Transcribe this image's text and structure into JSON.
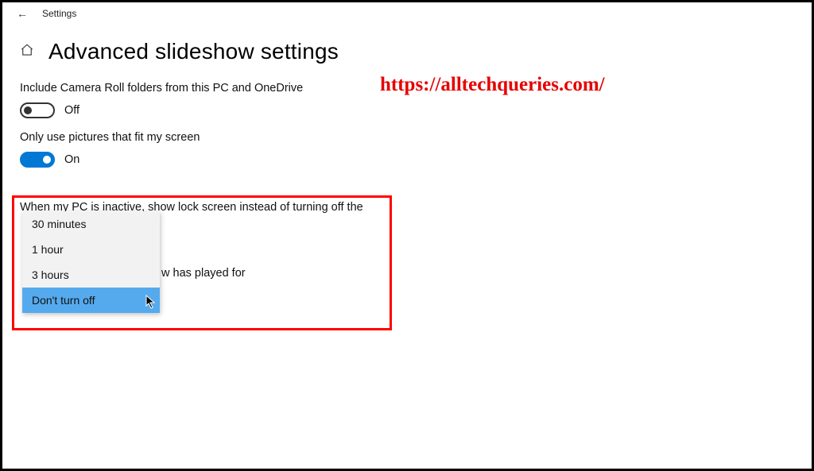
{
  "top": {
    "back": "←",
    "title": "Settings"
  },
  "page": {
    "title": "Advanced slideshow settings"
  },
  "watermark": "https://alltechqueries.com/",
  "settings": {
    "cameraRoll": {
      "label": "Include Camera Roll folders from this PC and OneDrive",
      "state": "Off"
    },
    "fitScreen": {
      "label": "Only use pictures that fit my screen",
      "state": "On"
    },
    "lockScreen": {
      "label": "When my PC is inactive, show lock screen instead of turning off the"
    },
    "playedFor": {
      "labelFragment": "w has played for"
    }
  },
  "dropdown": {
    "items": [
      "30 minutes",
      "1 hour",
      "3 hours",
      "Don't turn off"
    ],
    "selected": "Don't turn off"
  }
}
